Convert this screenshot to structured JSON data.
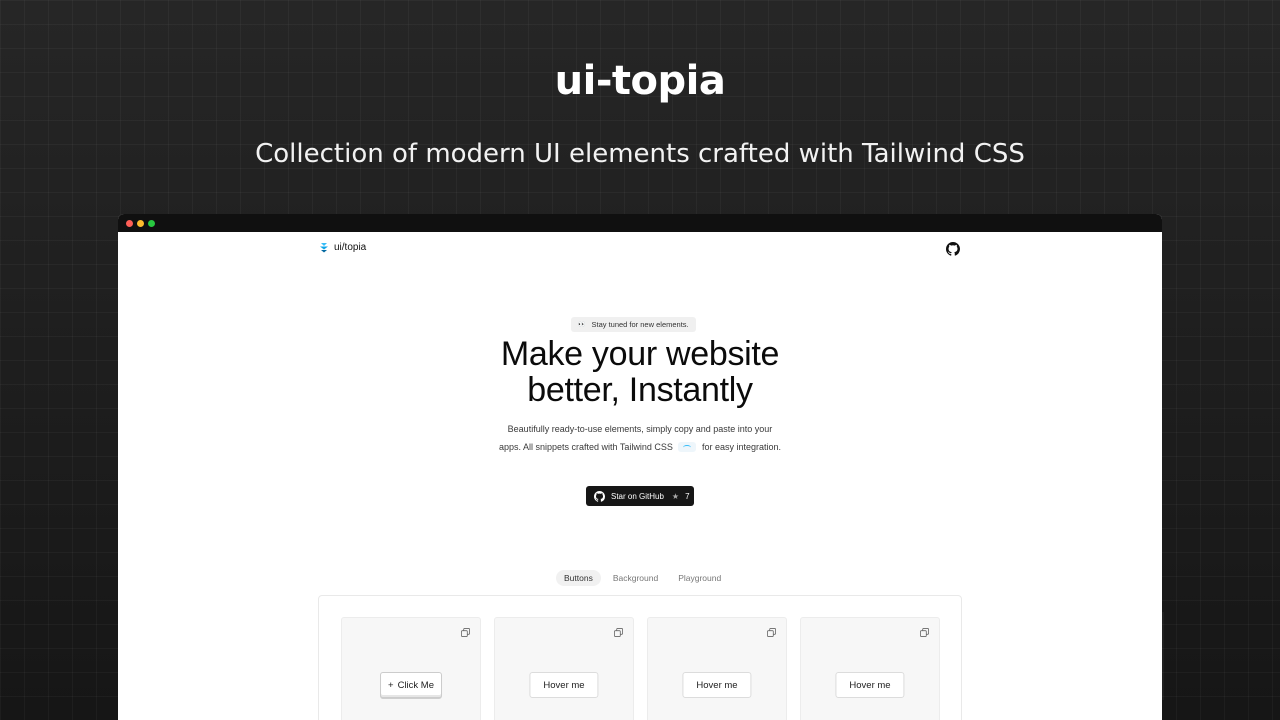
{
  "hero": {
    "title": "ui-topia",
    "subtitle": "Collection of modern UI elements crafted with Tailwind CSS"
  },
  "site": {
    "logo_text": "ui/topia",
    "github_icon": "github-icon",
    "badge": {
      "emoji": "👀",
      "text": "Stay tuned for new elements."
    },
    "heading_line1": "Make your website",
    "heading_line2": "better, Instantly",
    "description_line1": "Beautifully ready-to-use elements, simply copy and paste into your",
    "description_line2_a": "apps. All snippets crafted with Tailwind CSS",
    "description_line2_b": "for easy integration.",
    "star_button": {
      "label": "Star on GitHub",
      "star": "★",
      "count": "7"
    },
    "tabs": [
      {
        "label": "Buttons",
        "active": true
      },
      {
        "label": "Background",
        "active": false
      },
      {
        "label": "Playground",
        "active": false
      }
    ],
    "cards": [
      {
        "button_label": "Click Me",
        "button_icon": "+"
      },
      {
        "button_label": "Hover me"
      },
      {
        "button_label": "Hover me"
      },
      {
        "button_label": "Hover me"
      }
    ]
  },
  "colors": {
    "background": "#181818",
    "browser_bar": "#101010",
    "dot_red": "#ff5f57",
    "dot_yellow": "#febc2e",
    "dot_green": "#28c840",
    "accent_tailwind": "#38bdf8"
  }
}
